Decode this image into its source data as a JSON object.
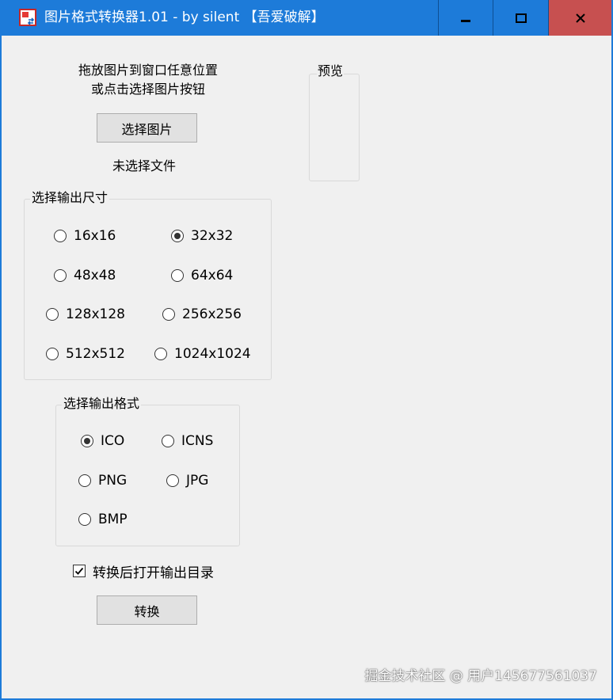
{
  "window": {
    "title": "图片格式转换器1.01 - by silent 【吾爱破解】",
    "controls": {
      "minimize_icon": "minimize-icon",
      "maximize_icon": "maximize-icon",
      "close_icon": "close-icon"
    }
  },
  "colors": {
    "titlebar": "#1d7bd9",
    "close_button": "#c75050",
    "client_background": "#f0f0f0",
    "button_background": "#e1e1e1"
  },
  "drop_hint": {
    "line1": "拖放图片到窗口任意位置",
    "line2": "或点击选择图片按钮"
  },
  "select_button_label": "选择图片",
  "file_status": "未选择文件",
  "preview_label": "预览",
  "size_group": {
    "label": "选择输出尺寸",
    "selected": "32x32",
    "options": [
      "16x16",
      "32x32",
      "48x48",
      "64x64",
      "128x128",
      "256x256",
      "512x512",
      "1024x1024"
    ]
  },
  "format_group": {
    "label": "选择输出格式",
    "selected": "ICO",
    "options": [
      "ICO",
      "ICNS",
      "PNG",
      "JPG",
      "BMP"
    ]
  },
  "open_dir_checkbox": {
    "label": "转换后打开输出目录",
    "checked": true
  },
  "convert_button_label": "转换",
  "watermark": "掘金技术社区 @ 用户14567756103​7"
}
